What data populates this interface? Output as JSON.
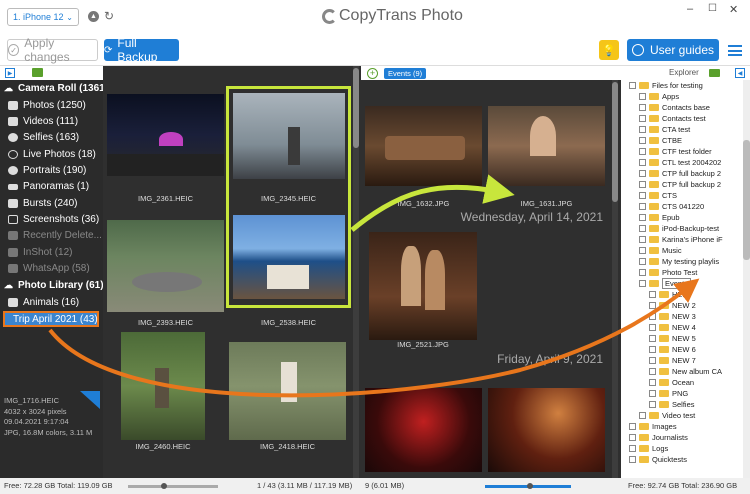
{
  "header": {
    "device": "1. iPhone 12",
    "app_title": "CopyTrans Photo",
    "window_controls": {
      "minimize": "–",
      "maximize": "☐",
      "close": "✕"
    }
  },
  "toolbar": {
    "apply_label": "Apply changes",
    "backup_label": "Full Backup",
    "guides_label": "User guides"
  },
  "sidebar": {
    "camera_roll": "Camera Roll (1361)",
    "items": [
      "Photos (1250)",
      "Videos (111)",
      "Selfies (163)",
      "Live Photos (18)",
      "Portraits (190)",
      "Panoramas (1)",
      "Bursts (240)",
      "Screenshots (36)",
      "Recently Delete...",
      "InShot (12)",
      "WhatsApp (58)"
    ],
    "photo_library": "Photo Library (61)",
    "animals": "Animals (16)",
    "trip": "Trip April 2021 (43)",
    "info": {
      "name": "IMG_1716.HEIC",
      "size": "4032 x 3024 pixels",
      "date": "09.04.2021 9:17:04",
      "format": "JPG, 16.8M colors, 3.11 M"
    }
  },
  "album_grid": {
    "captions": [
      "IMG_2361.HEIC",
      "IMG_2345.HEIC",
      "IMG_2393.HEIC",
      "IMG_2538.HEIC",
      "IMG_2460.HEIC",
      "IMG_2418.HEIC"
    ]
  },
  "events_pane": {
    "tab_label": "Events (9)",
    "captions": [
      "IMG_1632.JPG",
      "IMG_1631.JPG",
      "IMG_2521.JPG"
    ],
    "date1": "Wednesday, April 14, 2021",
    "date2": "Friday, April 9, 2021"
  },
  "explorer": {
    "title": "Explorer",
    "items": [
      "Files for testing",
      "Apps",
      "Contacts base",
      "Contacts test",
      "CTA test",
      "CTBE",
      "CTF test folder",
      "CTL test 2004202",
      "CTP full backup 2",
      "CTP full backup 2",
      "CTS",
      "CTS 041220",
      "Epub",
      "iPod-Backup-test",
      "Karina's iPhone iF",
      "Music",
      "My testing playlis",
      "Photo Test",
      "Events",
      "HEIC",
      "NEW 2",
      "NEW 3",
      "NEW 4",
      "NEW 5",
      "NEW 6",
      "NEW 7",
      "New album CA",
      "Ocean",
      "PNG",
      "Selfies",
      "Video test",
      "Images",
      "Journalists",
      "Logs",
      "Quicktests"
    ]
  },
  "status": {
    "left": "Free: 72.28 GB Total: 119.09 GB",
    "mid1": "1 / 43 (3.11 MB / 117.19 MB)",
    "mid2": "9 (6.01 MB)",
    "right": "Free: 92.74 GB Total: 236.90 GB"
  },
  "colors": {
    "accent": "#1f7ed6",
    "highlight": "#c8e63c",
    "arrow": "#e8761c"
  }
}
